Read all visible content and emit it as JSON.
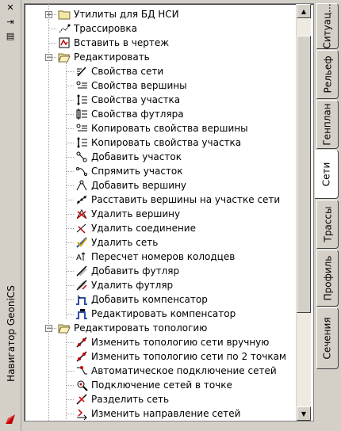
{
  "window": {
    "title": "Навигатор GeoniCS"
  },
  "tabs": [
    "Ситуац...",
    "Рельеф",
    "Генплан",
    "Сети",
    "Трассы",
    "Профиль",
    "Сечения"
  ],
  "active_tab": "Сети",
  "tree": {
    "items": [
      {
        "label": "Утилиты для БД НСИ",
        "icon": "folder-closed-icon",
        "level": 0,
        "expander": "+"
      },
      {
        "label": "Трассировка",
        "icon": "trace-icon",
        "level": 0
      },
      {
        "label": "Вставить в чертеж",
        "icon": "insert-drawing-icon",
        "level": 0
      },
      {
        "label": "Редактировать",
        "icon": "folder-open-icon",
        "level": 0,
        "expander": "-"
      },
      {
        "label": "Свойства сети",
        "icon": "network-properties-icon",
        "level": 1
      },
      {
        "label": "Свойства вершины",
        "icon": "vertex-properties-icon",
        "level": 1
      },
      {
        "label": "Свойства участка",
        "icon": "segment-properties-icon",
        "level": 1
      },
      {
        "label": "Свойства футляра",
        "icon": "case-properties-icon",
        "level": 1
      },
      {
        "label": "Копировать свойства вершины",
        "icon": "copy-vertex-properties-icon",
        "level": 1
      },
      {
        "label": "Копировать свойства участка",
        "icon": "copy-segment-properties-icon",
        "level": 1
      },
      {
        "label": "Добавить участок",
        "icon": "add-segment-icon",
        "level": 1
      },
      {
        "label": "Спрямить участок",
        "icon": "straighten-segment-icon",
        "level": 1
      },
      {
        "label": "Добавить вершину",
        "icon": "add-vertex-icon",
        "level": 1
      },
      {
        "label": "Расставить вершины на участке сети",
        "icon": "place-vertices-icon",
        "level": 1
      },
      {
        "label": "Удалить вершину",
        "icon": "delete-vertex-icon",
        "level": 1
      },
      {
        "label": "Удалить соединение",
        "icon": "delete-connection-icon",
        "level": 1
      },
      {
        "label": "Удалить сеть",
        "icon": "delete-network-icon",
        "level": 1
      },
      {
        "label": "Пересчет номеров колодцев",
        "icon": "renumber-wells-icon",
        "level": 1
      },
      {
        "label": "Добавить футляр",
        "icon": "add-case-icon",
        "level": 1
      },
      {
        "label": "Удалить футляр",
        "icon": "delete-case-icon",
        "level": 1
      },
      {
        "label": "Добавить компенсатор",
        "icon": "add-compensator-icon",
        "level": 1
      },
      {
        "label": "Редактировать компенсатор",
        "icon": "edit-compensator-icon",
        "level": 1
      },
      {
        "label": "Редактировать топологию",
        "icon": "folder-open-icon",
        "level": 0,
        "expander": "-"
      },
      {
        "label": "Изменить топологию сети вручную",
        "icon": "topology-manual-icon",
        "level": 1
      },
      {
        "label": "Изменить топологию сети по 2 точкам",
        "icon": "topology-two-points-icon",
        "level": 1
      },
      {
        "label": "Автоматическое подключение сетей",
        "icon": "auto-connect-icon",
        "level": 1
      },
      {
        "label": "Подключение сетей в точке",
        "icon": "connect-at-point-icon",
        "level": 1
      },
      {
        "label": "Разделить сеть",
        "icon": "split-network-icon",
        "level": 1
      },
      {
        "label": "Изменить направление сетей",
        "icon": "change-direction-icon",
        "level": 1
      }
    ]
  },
  "colors": {
    "accent": "#c00000",
    "folder": "#e8d58a",
    "chrome": "#d4d0c8"
  }
}
